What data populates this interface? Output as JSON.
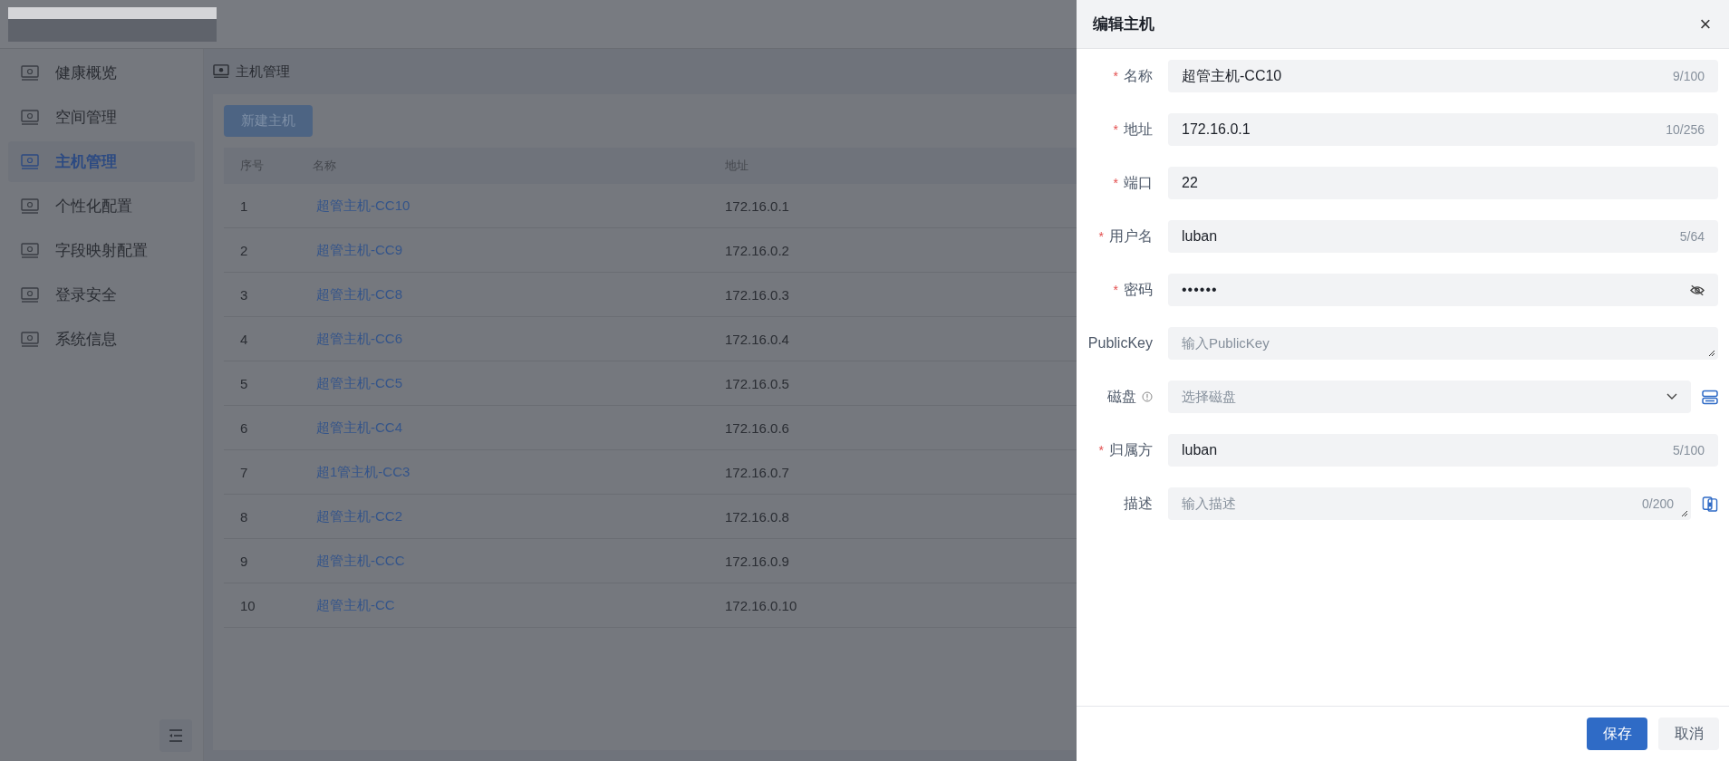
{
  "sidebar": {
    "items": [
      {
        "label": "健康概览",
        "selected": false
      },
      {
        "label": "空间管理",
        "selected": false
      },
      {
        "label": "主机管理",
        "selected": true
      },
      {
        "label": "个性化配置",
        "selected": false
      },
      {
        "label": "字段映射配置",
        "selected": false
      },
      {
        "label": "登录安全",
        "selected": false
      },
      {
        "label": "系统信息",
        "selected": false
      }
    ]
  },
  "breadcrumb": {
    "title": "主机管理"
  },
  "new_button": {
    "label": "新建主机"
  },
  "table": {
    "columns": [
      "序号",
      "名称",
      "地址"
    ],
    "rows": [
      {
        "index": "1",
        "name": "超管主机-CC10",
        "address": "172.16.0.1"
      },
      {
        "index": "2",
        "name": "超管主机-CC9",
        "address": "172.16.0.2"
      },
      {
        "index": "3",
        "name": "超管主机-CC8",
        "address": "172.16.0.3"
      },
      {
        "index": "4",
        "name": "超管主机-CC6",
        "address": "172.16.0.4"
      },
      {
        "index": "5",
        "name": "超管主机-CC5",
        "address": "172.16.0.5"
      },
      {
        "index": "6",
        "name": "超管主机-CC4",
        "address": "172.16.0.6"
      },
      {
        "index": "7",
        "name": "超1管主机-CC3",
        "address": "172.16.0.7"
      },
      {
        "index": "8",
        "name": "超管主机-CC2",
        "address": "172.16.0.8"
      },
      {
        "index": "9",
        "name": "超管主机-CCC",
        "address": "172.16.0.9"
      },
      {
        "index": "10",
        "name": "超管主机-CC",
        "address": "172.16.0.10"
      }
    ]
  },
  "drawer": {
    "title": "编辑主机",
    "close": "×",
    "fields": [
      {
        "kind": "text",
        "label": "名称",
        "required_mark": "*",
        "value": "超管主机-CC10",
        "counter": "9/100"
      },
      {
        "kind": "text",
        "label": "地址",
        "required_mark": "*",
        "value": "172.16.0.1",
        "counter": "10/256"
      },
      {
        "kind": "text",
        "label": "端口",
        "required_mark": "*",
        "value": "22"
      },
      {
        "kind": "text",
        "label": "用户名",
        "required_mark": "*",
        "value": "luban",
        "counter": "5/64"
      },
      {
        "kind": "password",
        "label": "密码",
        "required_mark": "*",
        "value": "••••••"
      },
      {
        "kind": "textarea",
        "label": "PublicKey",
        "placeholder": "输入PublicKey"
      },
      {
        "kind": "select",
        "label": "磁盘",
        "hint": true,
        "placeholder": "选择磁盘",
        "side_action": true
      },
      {
        "kind": "text",
        "label": "归属方",
        "required_mark": "*",
        "value": "luban",
        "counter": "5/100"
      },
      {
        "kind": "textarea",
        "label": "描述",
        "placeholder": "输入描述",
        "counter": "0/200",
        "side_action": true
      }
    ],
    "buttons": [
      {
        "label": "保存",
        "kind": "primary"
      },
      {
        "label": "取消",
        "kind": "default"
      }
    ]
  }
}
